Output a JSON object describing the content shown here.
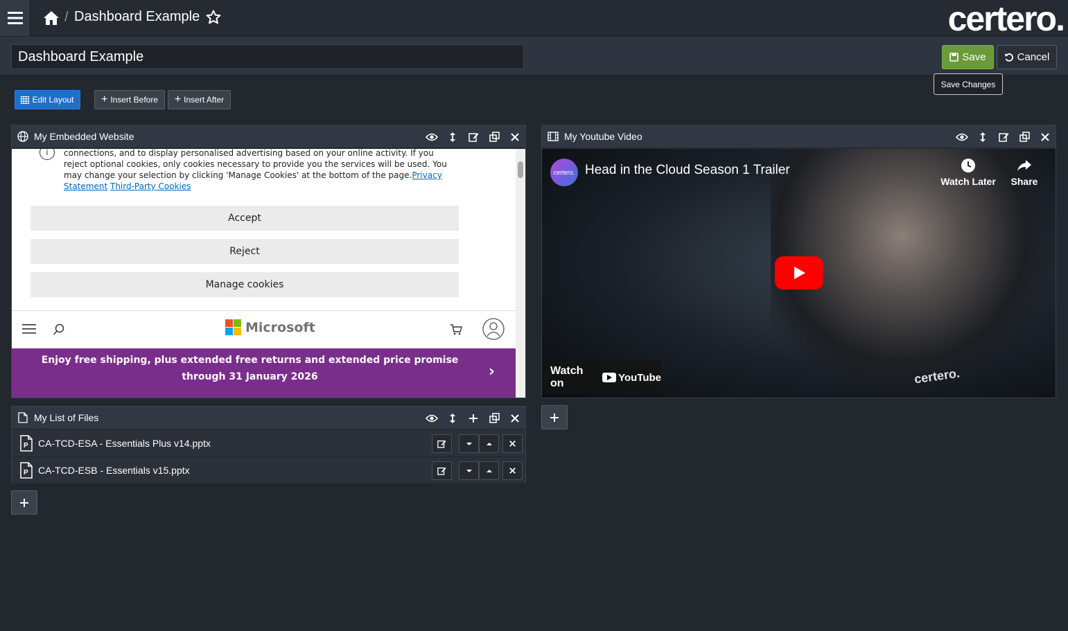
{
  "header": {
    "breadcrumb_sep": "/",
    "title": "Dashboard Example",
    "logo": "certero."
  },
  "title_row": {
    "dashboard_name": "Dashboard Example",
    "save_label": "Save",
    "cancel_label": "Cancel",
    "save_tooltip": "Save Changes"
  },
  "toolbar": {
    "edit_layout": "Edit Layout",
    "insert_before": "Insert Before",
    "insert_after": "Insert After"
  },
  "panels": {
    "website": {
      "title": "My Embedded Website",
      "cookie_text": "connections, and to display personalised advertising based on your online activity. If you reject optional cookies, only cookies necessary to provide you the services will be used. You may change your selection by clicking 'Manage Cookies' at the bottom of the page.",
      "privacy_link": "Privacy Statement",
      "third_party_link": "Third-Party Cookies",
      "accept": "Accept",
      "reject": "Reject",
      "manage": "Manage cookies",
      "brand": "Microsoft",
      "promo": "Enjoy free shipping, plus extended free returns and extended price promise through 31 January 2026"
    },
    "video": {
      "title": "My Youtube Video",
      "channel": "certero.",
      "video_title": "Head in the Cloud Season 1 Trailer",
      "watch_later": "Watch Later",
      "share": "Share",
      "watch_on": "Watch on",
      "youtube": "YouTube",
      "shirt_text": "certero."
    },
    "files": {
      "title": "My List of Files",
      "items": [
        {
          "name": "CA-TCD-ESA - Essentials Plus v14.pptx"
        },
        {
          "name": "CA-TCD-ESB - Essentials v15.pptx"
        }
      ]
    }
  },
  "colors": {
    "accent_blue": "#1f6fc9",
    "save_green": "#6a9a3a",
    "promo_purple": "#7a2e8c",
    "youtube_red": "#ff0000"
  },
  "icons": [
    "menu-icon",
    "home-icon",
    "star-icon",
    "globe-icon",
    "eye-icon",
    "resize-icon",
    "edit-icon",
    "copy-icon",
    "close-icon",
    "film-icon",
    "file-icon",
    "pptx-icon",
    "plus-icon",
    "chevron-down-icon",
    "chevron-up-icon",
    "clock-icon",
    "share-icon",
    "play-icon",
    "grid-icon",
    "save-icon",
    "undo-icon"
  ]
}
